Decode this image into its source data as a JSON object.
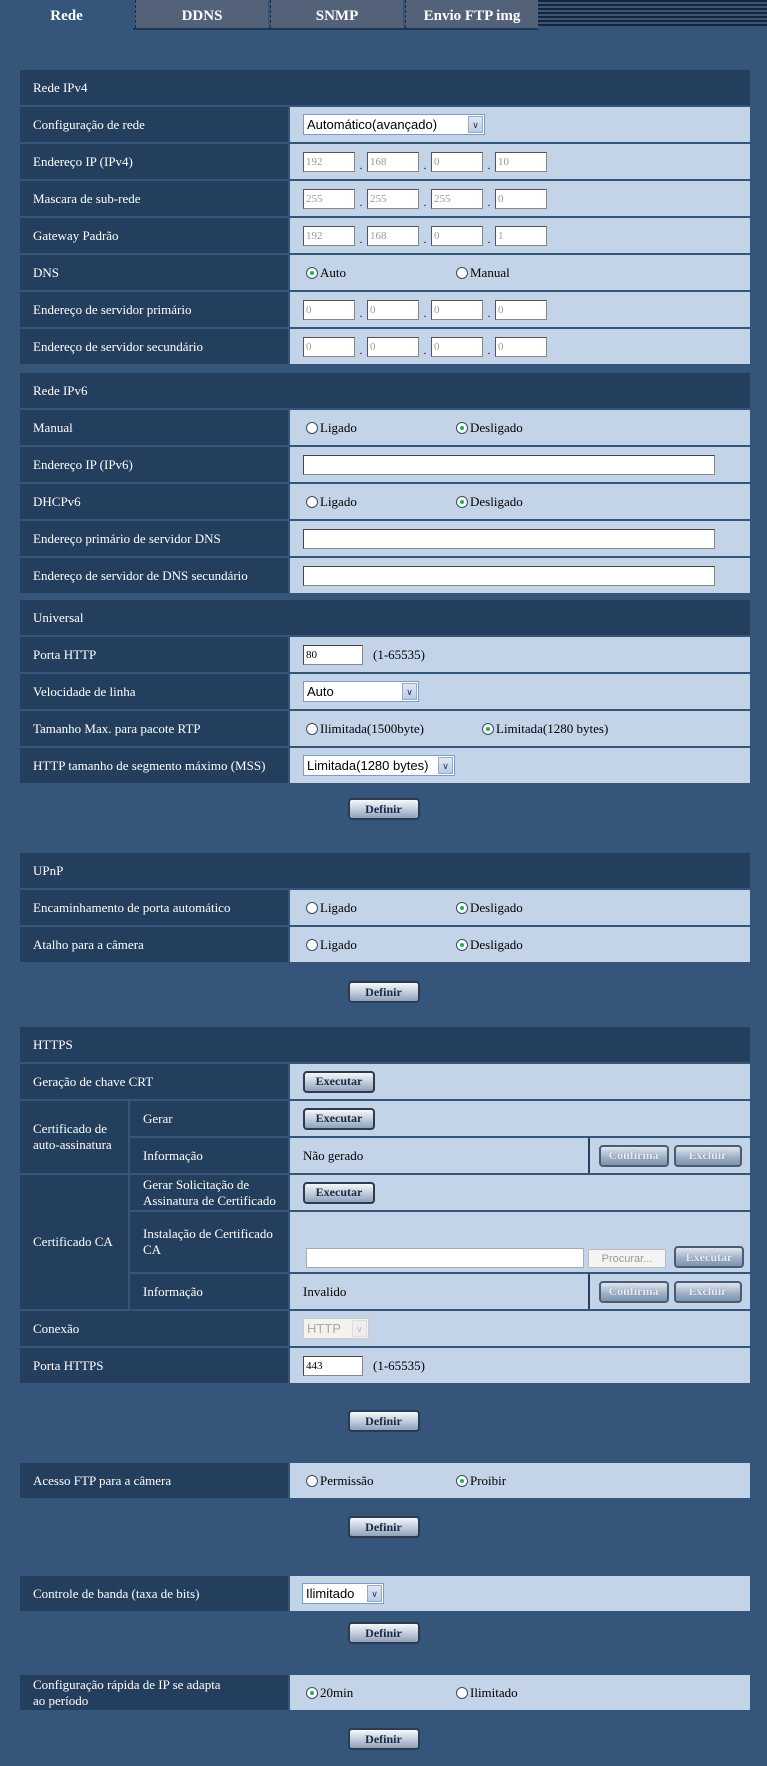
{
  "tabs": [
    {
      "label": "Rede",
      "active": true
    },
    {
      "label": "DDNS",
      "active": false
    },
    {
      "label": "SNMP",
      "active": false
    },
    {
      "label": "Envio FTP img",
      "active": false
    }
  ],
  "ipv4": {
    "title": "Rede IPv4",
    "network_config": {
      "label": "Configuração de rede",
      "value": "Automático(avançado)"
    },
    "ip_address": {
      "label": "Endereço IP (IPv4)",
      "octets": [
        "192",
        "168",
        "0",
        "10"
      ]
    },
    "subnet_mask": {
      "label": "Mascara de sub-rede",
      "octets": [
        "255",
        "255",
        "255",
        "0"
      ]
    },
    "gateway": {
      "label": "Gateway Padrão",
      "octets": [
        "192",
        "168",
        "0",
        "1"
      ]
    },
    "dns": {
      "label": "DNS",
      "options": [
        "Auto",
        "Manual"
      ],
      "selected": "Auto"
    },
    "primary_dns": {
      "label": "Endereço de servidor primário",
      "octets": [
        "0",
        "0",
        "0",
        "0"
      ]
    },
    "secondary_dns": {
      "label": "Endereço de servidor secundário",
      "octets": [
        "0",
        "0",
        "0",
        "0"
      ]
    }
  },
  "ipv6": {
    "title": "Rede IPv6",
    "manual": {
      "label": "Manual",
      "options": [
        "Ligado",
        "Desligado"
      ],
      "selected": "Desligado"
    },
    "ip_address": {
      "label": "Endereço IP (IPv6)",
      "value": ""
    },
    "dhcpv6": {
      "label": "DHCPv6",
      "options": [
        "Ligado",
        "Desligado"
      ],
      "selected": "Desligado"
    },
    "primary_dns": {
      "label": "Endereço primário de servidor DNS",
      "value": ""
    },
    "secondary_dns": {
      "label": "Endereço de servidor de DNS secundário",
      "value": ""
    }
  },
  "universal": {
    "title": "Universal",
    "http_port": {
      "label": "Porta HTTP",
      "value": "80",
      "range": "(1-65535)"
    },
    "line_speed": {
      "label": "Velocidade de linha",
      "value": "Auto"
    },
    "rtp_max": {
      "label": "Tamanho Max. para pacote RTP",
      "options": [
        "Ilimitada(1500byte)",
        "Limitada(1280 bytes)"
      ],
      "selected": "Limitada(1280 bytes)"
    },
    "mss": {
      "label": "HTTP tamanho de segmento máximo (MSS)",
      "value": "Limitada(1280 bytes)"
    }
  },
  "upnp": {
    "title": "UPnP",
    "port_forwarding": {
      "label": "Encaminhamento de porta automático",
      "options": [
        "Ligado",
        "Desligado"
      ],
      "selected": "Desligado"
    },
    "camera_shortcut": {
      "label": "Atalho para a câmera",
      "options": [
        "Ligado",
        "Desligado"
      ],
      "selected": "Desligado"
    }
  },
  "https": {
    "title": "HTTPS",
    "crt_key": {
      "label": "Geração de chave CRT",
      "button": "Executar"
    },
    "self_signed": {
      "label": "Certificado de auto-assinatura",
      "generate": {
        "label": "Gerar",
        "button": "Executar"
      },
      "info": {
        "label": "Informação",
        "value": "Não gerado",
        "confirm": "Confirma",
        "delete": "Excluir"
      }
    },
    "ca": {
      "label": "Certificado CA",
      "csr": {
        "label": "Gerar Solicitação de Assinatura de Certificado",
        "button": "Executar"
      },
      "install": {
        "label": "Instalação de Certificado CA",
        "file_value": "",
        "browse": "Procurar...",
        "button": "Executar"
      },
      "info": {
        "label": "Informação",
        "value": "Invalido",
        "confirm": "Confirma",
        "delete": "Excluir"
      }
    },
    "connection": {
      "label": "Conexão",
      "value": "HTTP"
    },
    "https_port": {
      "label": "Porta HTTPS",
      "value": "443",
      "range": "(1-65535)"
    }
  },
  "ftp_access": {
    "label": "Acesso FTP para a câmera",
    "options": [
      "Permissão",
      "Proibir"
    ],
    "selected": "Proibir"
  },
  "bandwidth": {
    "label": "Controle de banda (taxa de bits)",
    "value": "Ilimitado"
  },
  "quick_ip": {
    "label": "Configuração rápida de IP se adapta ao período",
    "options": [
      "20min",
      "Ilimitado"
    ],
    "selected": "20min"
  },
  "buttons": {
    "set": "Definir"
  }
}
